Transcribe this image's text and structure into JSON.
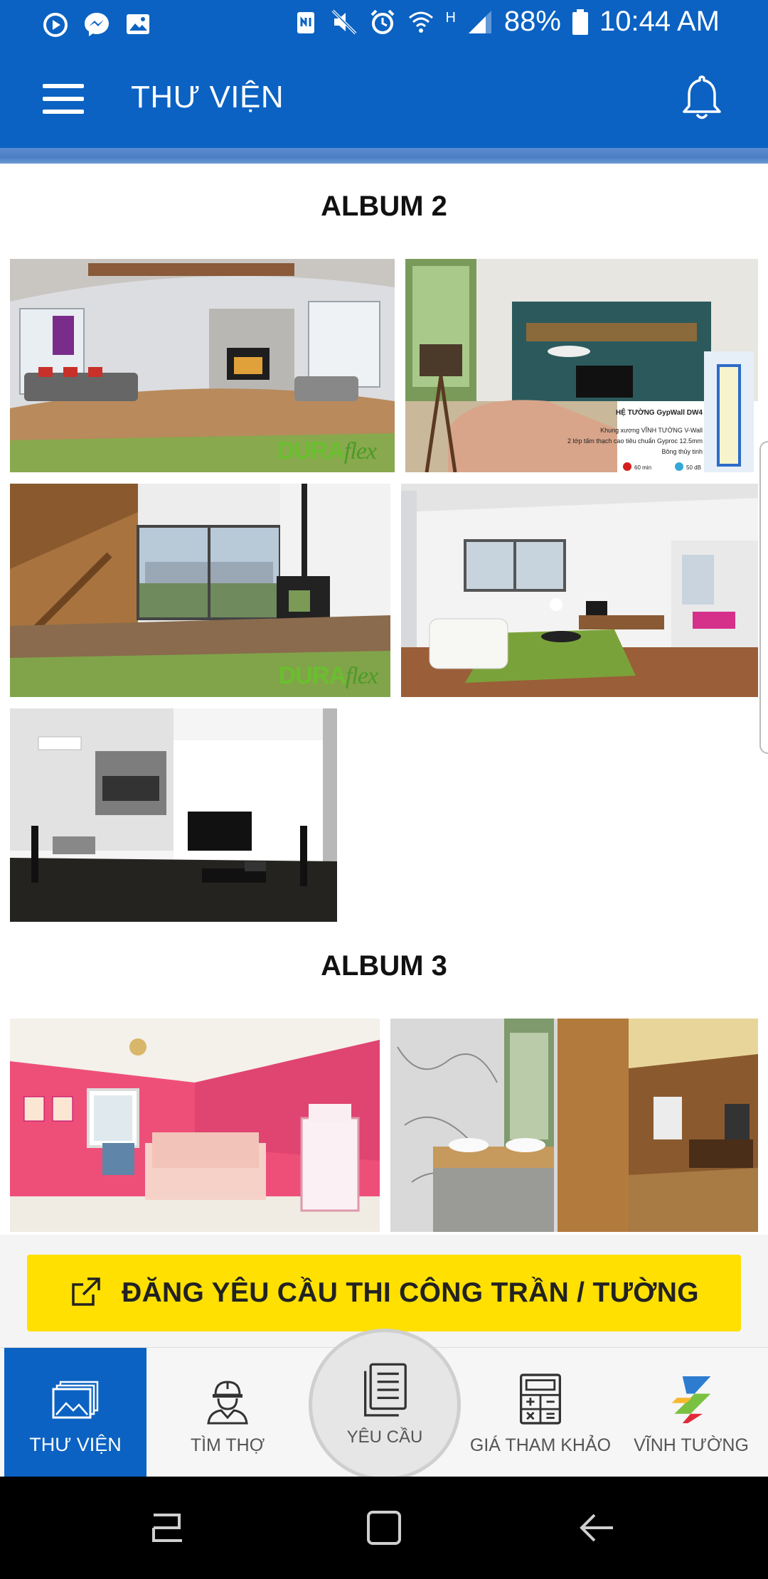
{
  "status_bar": {
    "battery": "88%",
    "time": "10:44 AM",
    "network": "H",
    "left_icons": [
      "media-play-icon",
      "messenger-icon",
      "gallery-icon"
    ],
    "right_icons": [
      "nfc-icon",
      "mute-icon",
      "alarm-icon",
      "wifi-icon",
      "signal-icon",
      "battery-icon"
    ]
  },
  "app_bar": {
    "title": "THƯ VIỆN",
    "menu_icon": "hamburger-menu-icon",
    "bell_icon": "notification-bell-icon"
  },
  "albums": [
    {
      "title": "ALBUM 2",
      "photos": [
        {
          "scene": "living room with fireplace",
          "watermark_bold": "DURA",
          "watermark_italic": "flex"
        },
        {
          "scene": "living room with teal wall and TV",
          "overlay": {
            "heading": "HỆ TƯỜNG GypWall DW4",
            "lines": [
              "Khung xương VĨNH TƯỜNG V-Wall",
              "2 lớp tấm thạch cao tiêu chuẩn Gyproc 12.5mm",
              "Bông thủy tinh"
            ],
            "badge_1": "60 min",
            "badge_2": "50 dB"
          }
        },
        {
          "scene": "wood stair interior with stove",
          "watermark_bold": "DURA",
          "watermark_italic": "flex"
        },
        {
          "scene": "white living room with green rug"
        },
        {
          "scene": "modern black and white room"
        }
      ]
    },
    {
      "title": "ALBUM 3",
      "photos": [
        {
          "scene": "pink kids bedroom"
        },
        {
          "scene": "marble bathroom and wooden hallway"
        }
      ]
    }
  ],
  "action": {
    "label": "ĐĂNG YÊU CẦU THI CÔNG TRẦN / TƯỜNG",
    "icon": "external-link-icon",
    "color": "#ffe000"
  },
  "bottom_nav": {
    "items": [
      {
        "label": "THƯ VIỆN",
        "icon": "gallery-stack-icon",
        "active": true
      },
      {
        "label": "TÌM THỢ",
        "icon": "worker-helmet-icon",
        "active": false
      },
      {
        "label": "YÊU CẦU",
        "icon": "document-list-icon",
        "active": false
      },
      {
        "label": "GIÁ THAM KHẢO",
        "icon": "calculator-icon",
        "active": false
      },
      {
        "label": "VĨNH TƯỜNG",
        "icon": "brand-logo-icon",
        "active": false
      }
    ]
  },
  "colors": {
    "primary": "#0b62c2",
    "accent": "#ffe000",
    "nav_background": "#f6f6f6"
  }
}
